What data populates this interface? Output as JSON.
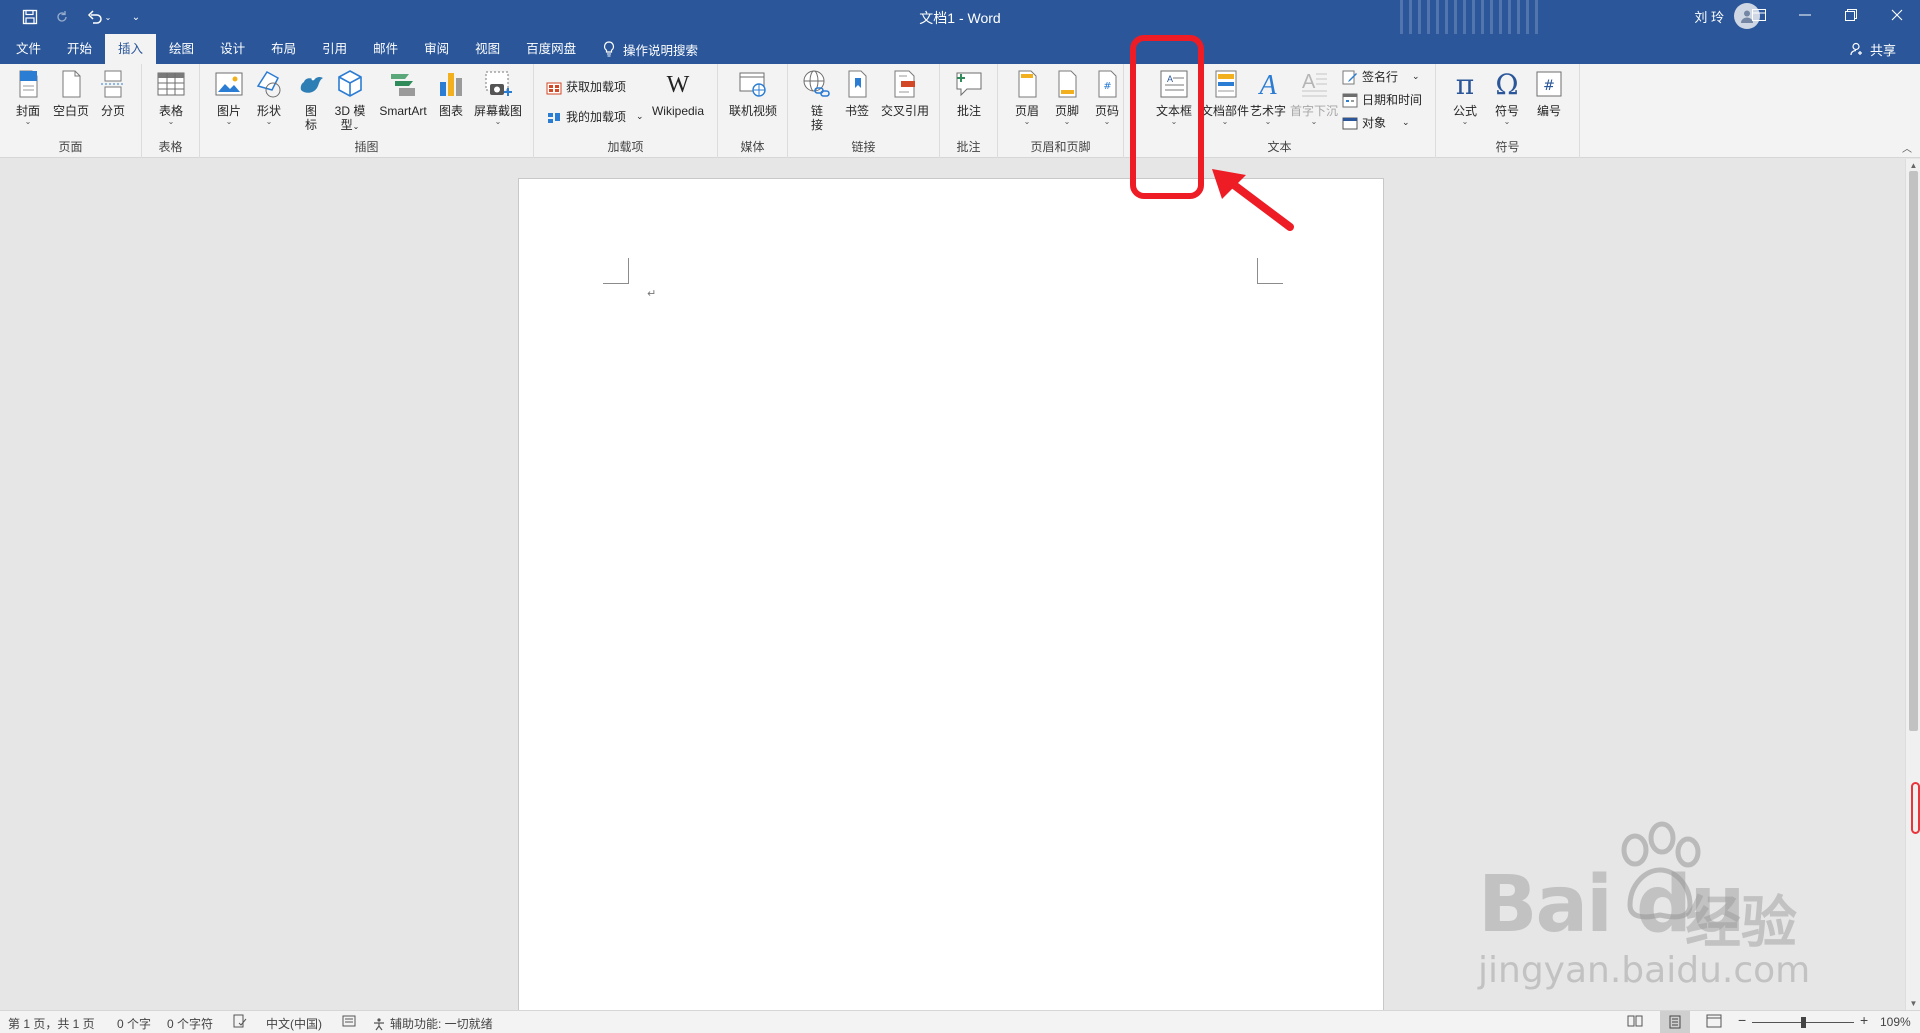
{
  "app": {
    "title": "文档1 - Word",
    "user_name": "刘 玲",
    "share_label": "共享"
  },
  "tabs": [
    "文件",
    "开始",
    "插入",
    "绘图",
    "设计",
    "布局",
    "引用",
    "邮件",
    "审阅",
    "视图",
    "百度网盘"
  ],
  "active_tab": "插入",
  "tell_me": "操作说明搜索",
  "ribbon": {
    "groups": {
      "pages": "页面",
      "tables": "表格",
      "illustrations": "插图",
      "addins": "加载项",
      "media": "媒体",
      "links": "链接",
      "comments": "批注",
      "header_footer": "页眉和页脚",
      "text": "文本",
      "symbols": "符号"
    },
    "buttons": {
      "cover": "封面",
      "blank_page": "空白页",
      "page_break": "分页",
      "table": "表格",
      "picture": "图片",
      "shapes": "形状",
      "icons_1": "图",
      "icons_2": "标",
      "model3d_1": "3D 模",
      "model3d_2": "型",
      "smartart": "SmartArt",
      "chart": "图表",
      "screenshot": "屏幕截图",
      "get_addins": "获取加载项",
      "my_addins": "我的加载项",
      "wikipedia": "Wikipedia",
      "online_video": "联机视频",
      "link_1": "链",
      "link_2": "接",
      "bookmark": "书签",
      "cross_ref": "交叉引用",
      "comment": "批注",
      "header": "页眉",
      "footer": "页脚",
      "page_number": "页码",
      "textbox": "文本框",
      "quick_parts": "文档部件",
      "wordart": "艺术字",
      "drop_cap": "首字下沉",
      "signature_line": "签名行",
      "date_time": "日期和时间",
      "object": "对象",
      "equation": "公式",
      "symbol": "符号",
      "numbering": "编号"
    }
  },
  "status": {
    "page": "第 1 页，共 1 页",
    "words": "0 个字",
    "chars": "0 个字符",
    "language": "中文(中国)",
    "accessibility": "辅助功能: 一切就绪",
    "zoom": "109%"
  },
  "watermark": {
    "brand": "Bai du",
    "cn": "经验",
    "url": "jingyan.baidu.com"
  },
  "colors": {
    "titlebar": "#2b579a",
    "annotation": "#ee1c25"
  }
}
